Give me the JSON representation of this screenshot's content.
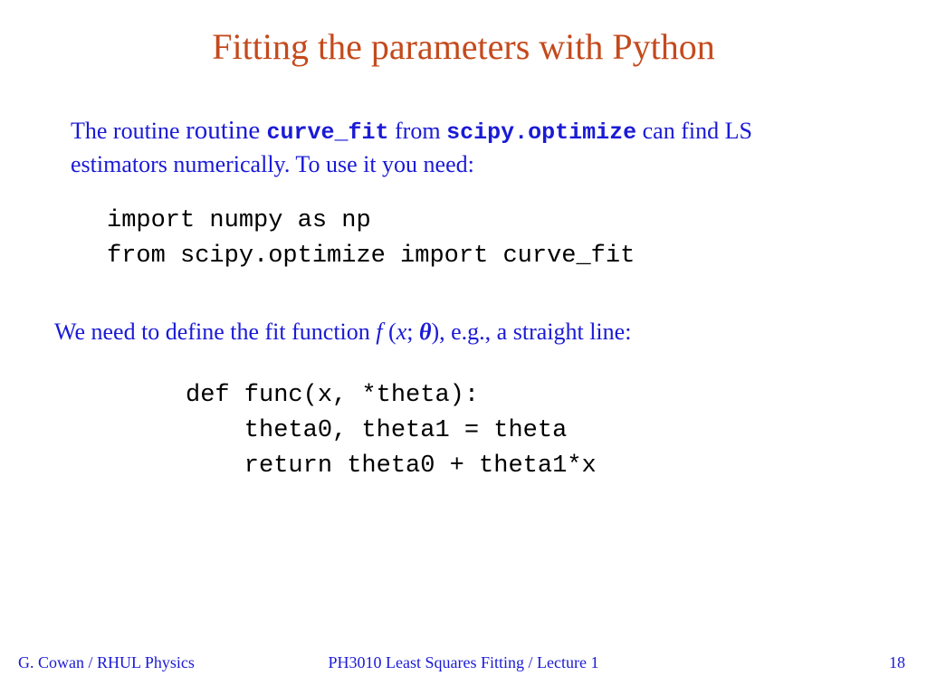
{
  "title": "Fitting the parameters with Python",
  "para1": {
    "t1": "The routine ",
    "t2": "routine ",
    "t3": "curve_fit",
    "t4": " from ",
    "t5": "scipy.optimize",
    "t6": " can find LS estimators numerically.   To use it you need:"
  },
  "code1": "import numpy as np\nfrom scipy.optimize import curve_fit",
  "para2": {
    "t1": "We need to define the fit function ",
    "f": "f ",
    "open": "(",
    "x": "x",
    "sep": "; ",
    "theta": "θ",
    "close": ")",
    "t2": ", e.g., a straight line:"
  },
  "code2": "def func(x, *theta):\n    theta0, theta1 = theta\n    return theta0 + theta1*x",
  "footer": {
    "left": "G. Cowan / RHUL Physics",
    "center": "PH3010 Least Squares Fitting / Lecture 1",
    "right": "18"
  }
}
